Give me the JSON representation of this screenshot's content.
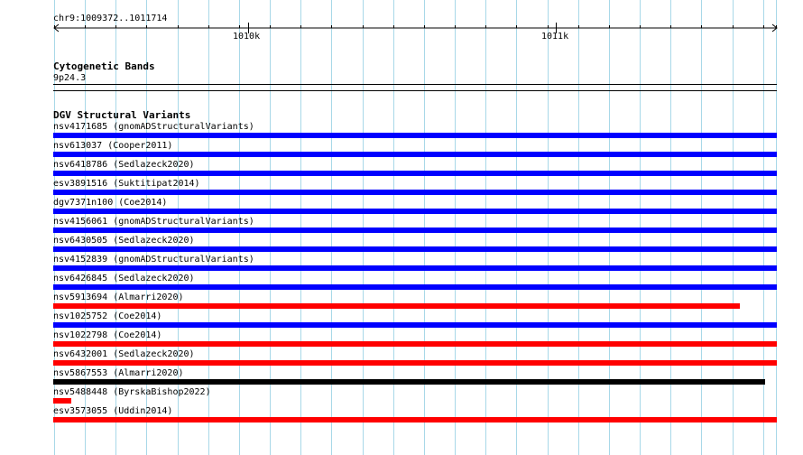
{
  "ruler": {
    "position": "chr9:1009372..1011714",
    "tick_labels": [
      "1010k",
      "1011k"
    ]
  },
  "cytoband": {
    "title": "Cytogenetic Bands",
    "band": "9p24.3"
  },
  "dgv": {
    "title": "DGV Structural Variants",
    "features": [
      {
        "label": "nsv4171685 (gnomADStructuralVariants)",
        "color": "#0000ff"
      },
      {
        "label": "nsv613037 (Cooper2011)",
        "color": "#0000ff"
      },
      {
        "label": "nsv6418786 (Sedlazeck2020)",
        "color": "#0000ff"
      },
      {
        "label": "esv3891516 (Suktitipat2014)",
        "color": "#0000ff"
      },
      {
        "label": "dgv7371n100 (Coe2014)",
        "color": "#0000ff"
      },
      {
        "label": "nsv4156061 (gnomADStructuralVariants)",
        "color": "#0000ff"
      },
      {
        "label": "nsv6430505 (Sedlazeck2020)",
        "color": "#0000ff"
      },
      {
        "label": "nsv4152839 (gnomADStructuralVariants)",
        "color": "#0000ff"
      },
      {
        "label": "nsv6426845 (Sedlazeck2020)",
        "color": "#0000ff"
      },
      {
        "label": "nsv5913694 (Almarri2020)",
        "color": "#ff0000"
      },
      {
        "label": "nsv1025752 (Coe2014)",
        "color": "#0000ff"
      },
      {
        "label": "nsv1022798 (Coe2014)",
        "color": "#ff0000"
      },
      {
        "label": "nsv6432001 (Sedlazeck2020)",
        "color": "#ff0000"
      },
      {
        "label": "nsv5867553 (Almarri2020)",
        "color": "#000000"
      },
      {
        "label": "nsv5488448 (ByrskaBishop2022)",
        "color": "#ff0000"
      },
      {
        "label": "esv3573055 (Uddin2014)",
        "color": "#ff0000"
      }
    ]
  }
}
